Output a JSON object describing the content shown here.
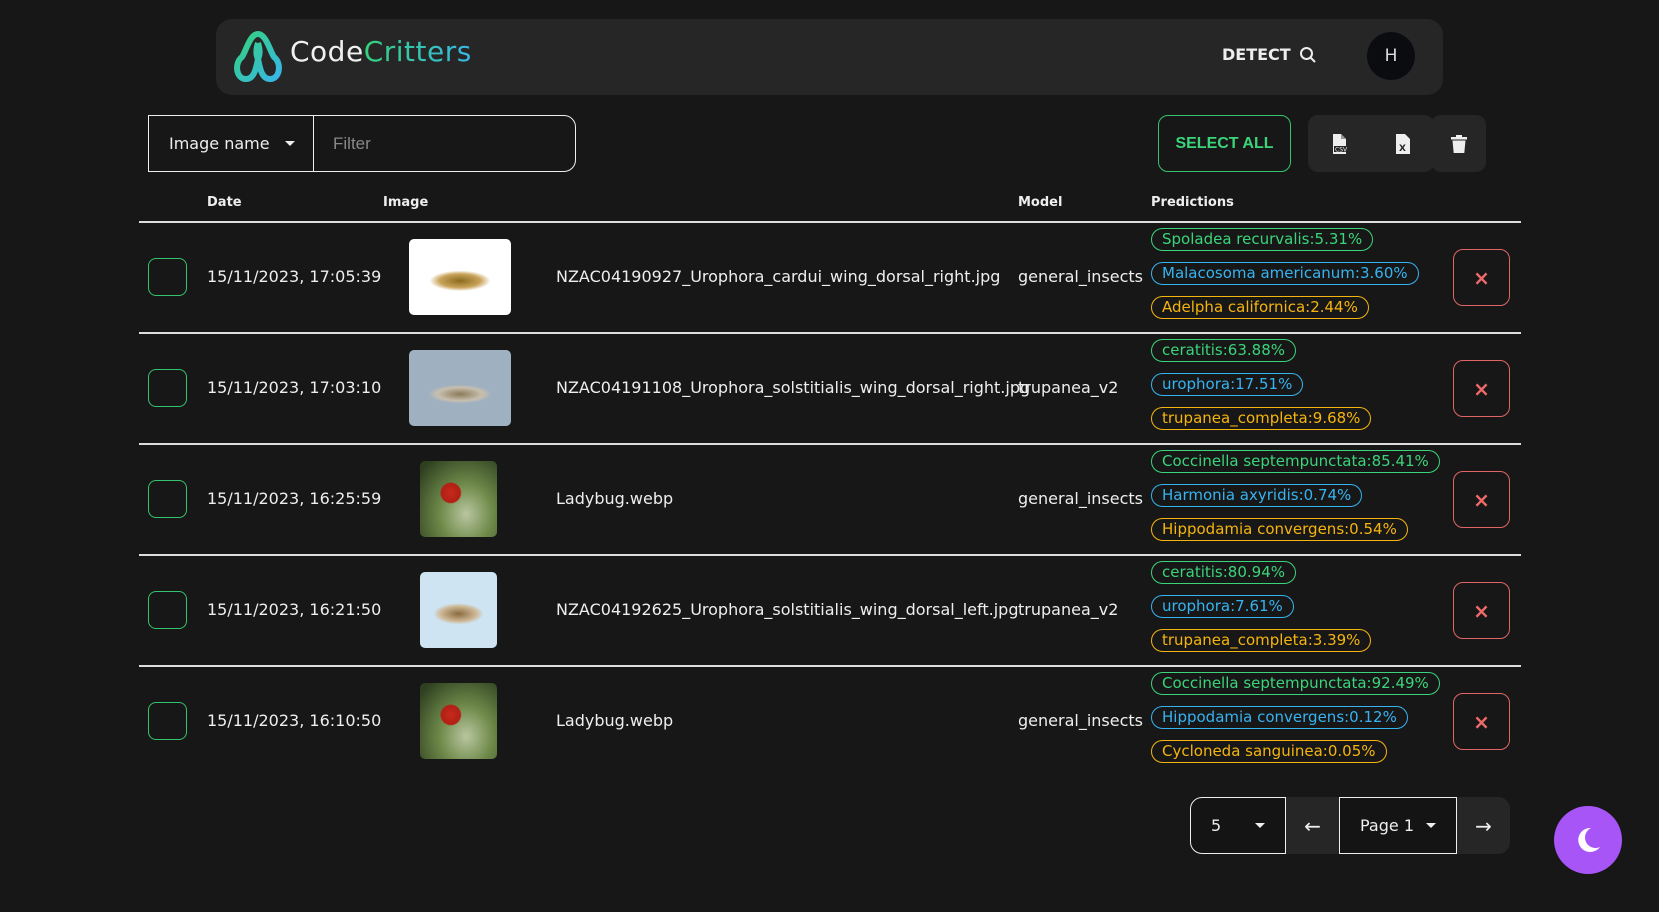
{
  "header": {
    "brand_part1": "Code",
    "brand_part2": "Critters",
    "detect_label": "DETECT",
    "avatar_initial": "H"
  },
  "filter": {
    "field_selected": "Image name",
    "placeholder": "Filter",
    "value": ""
  },
  "toolbar": {
    "select_all_label": "SELECT ALL",
    "export_csv_icon": "file-csv-icon",
    "export_excel_icon": "file-excel-icon",
    "delete_icon": "trash-icon"
  },
  "table": {
    "columns": [
      "Date",
      "Image",
      "Model",
      "Predictions"
    ],
    "rows": [
      {
        "date": "15/11/2023, 17:05:39",
        "image": "NZAC04190927_Urophora_cardui_wing_dorsal_right.jpg",
        "model": "general_insects",
        "predictions": [
          "Spoladea recurvalis:5.31%",
          "Malacosoma americanum:3.60%",
          "Adelpha californica:2.44%"
        ]
      },
      {
        "date": "15/11/2023, 17:03:10",
        "image": "NZAC04191108_Urophora_solstitialis_wing_dorsal_right.jpg",
        "model": "trupanea_v2",
        "predictions": [
          "ceratitis:63.88%",
          "urophora:17.51%",
          "trupanea_completa:9.68%"
        ]
      },
      {
        "date": "15/11/2023, 16:25:59",
        "image": "Ladybug.webp",
        "model": "general_insects",
        "predictions": [
          "Coccinella septempunctata:85.41%",
          "Harmonia axyridis:0.74%",
          "Hippodamia convergens:0.54%"
        ]
      },
      {
        "date": "15/11/2023, 16:21:50",
        "image": "NZAC04192625_Urophora_solstitialis_wing_dorsal_left.jpg",
        "model": "trupanea_v2",
        "predictions": [
          "ceratitis:80.94%",
          "urophora:7.61%",
          "trupanea_completa:3.39%"
        ]
      },
      {
        "date": "15/11/2023, 16:10:50",
        "image": "Ladybug.webp",
        "model": "general_insects",
        "predictions": [
          "Coccinella septempunctata:92.49%",
          "Hippodamia convergens:0.12%",
          "Cycloneda sanguinea:0.05%"
        ]
      }
    ]
  },
  "pagination": {
    "page_size": "5",
    "page": "Page 1"
  },
  "colors": {
    "accent_green": "#3bd47a",
    "accent_blue": "#36b3f0",
    "accent_yellow": "#f5b50e",
    "danger": "#f06a6a",
    "theme_toggle": "#a855f7"
  }
}
